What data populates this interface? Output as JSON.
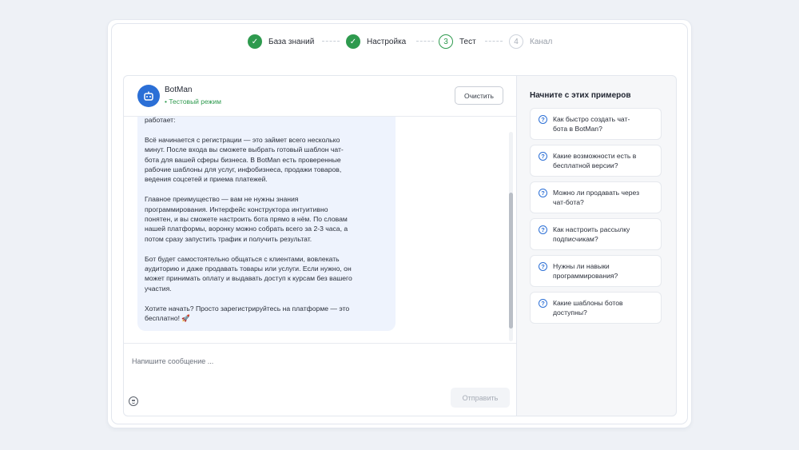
{
  "stepper": {
    "steps": [
      {
        "label": "База знаний",
        "state": "done",
        "marker": "✓"
      },
      {
        "label": "Настройка",
        "state": "done",
        "marker": "✓"
      },
      {
        "label": "Тест",
        "state": "active",
        "marker": "3"
      },
      {
        "label": "Канал",
        "state": "todo",
        "marker": "4"
      }
    ]
  },
  "chat": {
    "bot_name": "BotMan",
    "bot_mode": "• Тестовый режим",
    "clear_label": "Очистить",
    "message_paragraphs": [
      "работает:",
      "Всё начинается с регистрации — это займет всего несколько\nминут. После входа вы сможете выбрать готовый шаблон чат-\nбота для вашей сферы бизнеса. В BotMan есть проверенные\nрабочие шаблоны для услуг, инфобизнеса, продажи товаров,\nведения соцсетей и приема платежей.",
      "Главное преимущество — вам не нужны знания\nпрограммирования. Интерфейс конструктора интуитивно\nпонятен, и вы сможете настроить бота прямо в нём. По словам\nнашей платформы, воронку можно собрать всего за 2-3 часа, а\nпотом сразу запустить трафик и получить результат.",
      "Бот будет самостоятельно общаться с клиентами, вовлекать\nаудиторию и даже продавать товары или услуги. Если нужно, он\nможет принимать оплату и выдавать доступ к курсам без вашего\nучастия.",
      "Хотите начать? Просто зарегистрируйтесь на платформе — это\nбесплатно! 🚀"
    ],
    "input_placeholder": "Напишите сообщение ...",
    "send_label": "Отправить"
  },
  "examples": {
    "title": "Начните с этих примеров",
    "items": [
      "Как быстро создать чат-\nбота в BotMan?",
      "Какие возможности есть в\nбесплатной версии?",
      "Можно ли продавать через\nчат-бота?",
      "Как настроить рассылку\nподписчикам?",
      "Нужны ли навыки\nпрограммирования?",
      "Какие шаблоны ботов\nдоступны?"
    ]
  },
  "colors": {
    "accent": "#2b6fd6",
    "success": "#2e9a4e",
    "bubble": "#eef3fd",
    "background": "#eef1f6"
  }
}
